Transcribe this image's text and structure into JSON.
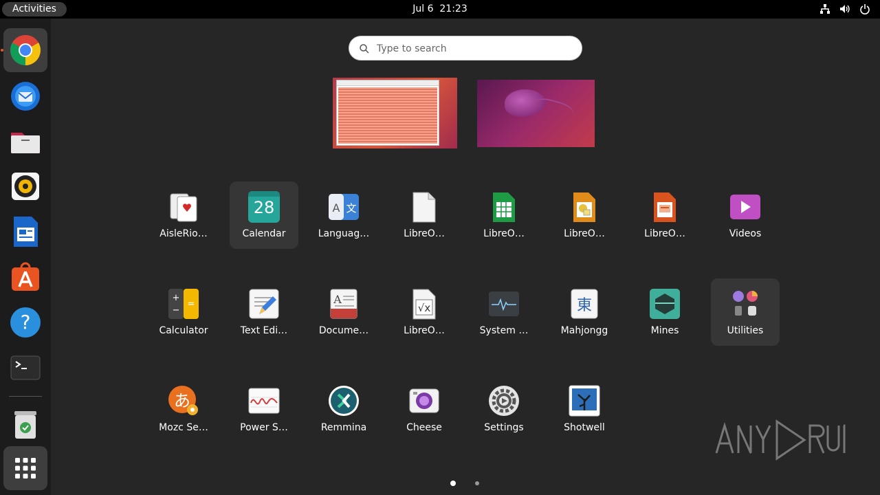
{
  "topbar": {
    "activities": "Activities",
    "clock": "Jul 6  21:23",
    "tray_icons": [
      "network-icon",
      "volume-icon",
      "power-icon"
    ]
  },
  "dock": {
    "items": [
      {
        "name": "chrome",
        "icon": "chrome-icon",
        "running": true
      },
      {
        "name": "thunderbird",
        "icon": "thunderbird-icon"
      },
      {
        "name": "files",
        "icon": "files-icon"
      },
      {
        "name": "rhythmbox",
        "icon": "rhythmbox-icon"
      },
      {
        "name": "libreoffice-writer",
        "icon": "writer-icon"
      },
      {
        "name": "app-center",
        "icon": "app-center-icon"
      },
      {
        "name": "help",
        "icon": "help-icon"
      },
      {
        "name": "terminal",
        "icon": "terminal-icon"
      },
      {
        "name": "trash",
        "icon": "trash-icon"
      },
      {
        "name": "show-apps",
        "icon": "app-grid-icon"
      }
    ]
  },
  "search": {
    "placeholder": "Type to search"
  },
  "apps": [
    {
      "label": "AisleRio…",
      "icon": "aisleriot-icon"
    },
    {
      "label": "Calendar",
      "icon": "calendar-icon",
      "day": "28"
    },
    {
      "label": "Languag…",
      "icon": "language-icon"
    },
    {
      "label": "LibreO…",
      "icon": "libreoffice-icon"
    },
    {
      "label": "LibreO…",
      "icon": "libreoffice-calc-icon"
    },
    {
      "label": "LibreO…",
      "icon": "libreoffice-draw-icon"
    },
    {
      "label": "LibreO…",
      "icon": "libreoffice-impress-icon"
    },
    {
      "label": "Videos",
      "icon": "videos-icon"
    },
    {
      "label": "Calculator",
      "icon": "calculator-icon"
    },
    {
      "label": "Text Edi…",
      "icon": "text-editor-icon"
    },
    {
      "label": "Docume…",
      "icon": "document-viewer-icon"
    },
    {
      "label": "LibreO…",
      "icon": "libreoffice-math-icon"
    },
    {
      "label": "System …",
      "icon": "system-monitor-icon"
    },
    {
      "label": "Mahjongg",
      "icon": "mahjongg-icon"
    },
    {
      "label": "Mines",
      "icon": "mines-icon"
    },
    {
      "label": "Utilities",
      "icon": "utilities-folder-icon"
    },
    {
      "label": "Mozc Se…",
      "icon": "mozc-icon"
    },
    {
      "label": "Power S…",
      "icon": "power-statistics-icon"
    },
    {
      "label": "Remmina",
      "icon": "remmina-icon"
    },
    {
      "label": "Cheese",
      "icon": "cheese-icon"
    },
    {
      "label": "Settings",
      "icon": "settings-icon"
    },
    {
      "label": "Shotwell",
      "icon": "shotwell-icon"
    }
  ],
  "pages": {
    "current": 1,
    "total": 2
  },
  "colors": {
    "accent": "#e95420",
    "panel": "#000000",
    "background": "#262626"
  }
}
